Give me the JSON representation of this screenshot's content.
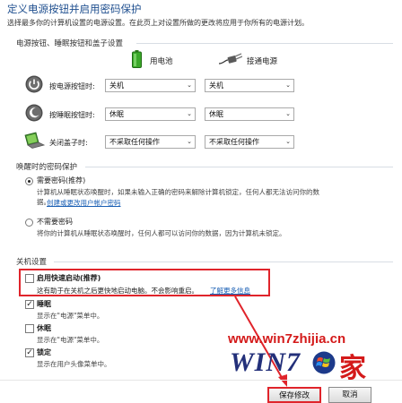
{
  "header": {
    "title": "定义电源按钮并启用密码保护",
    "description": "选择最多你的计算机设置的电源设置。在此页上对设置所做的更改将应用于你所有的电源计划。"
  },
  "power_buttons": {
    "section_title": "电源按钮、睡眠按钮和盖子设置",
    "col_battery": "用电池",
    "col_plugged": "接通电源",
    "rows": [
      {
        "label": "按电源按钮时:",
        "icon": "power-icon",
        "battery": "关机",
        "plugged": "关机"
      },
      {
        "label": "按睡眠按钮时:",
        "icon": "sleep-moon-icon",
        "battery": "休眠",
        "plugged": "休眠"
      },
      {
        "label": "关闭盖子时:",
        "icon": "laptop-lid-icon",
        "battery": "不采取任何操作",
        "plugged": "不采取任何操作"
      }
    ]
  },
  "password": {
    "section_title": "唤醒时的密码保护",
    "option_require": {
      "label": "需要密码(推荐)",
      "desc_line1": "计算机从睡眠状态唤醒时，如果未输入正确的密码来解除计算机锁定，任何人都无法访问你的数",
      "desc_line2": "据。",
      "link": "创建或更改用户帐户密码",
      "selected": true
    },
    "option_none": {
      "label": "不需要密码",
      "desc": "将你的计算机从睡眠状态唤醒时，任何人都可以访问你的数据，因为计算机未锁定。",
      "selected": false
    }
  },
  "shutdown": {
    "section_title": "关机设置",
    "fast_startup": {
      "label": "启用快速启动(推荐)",
      "desc": "这有助于在关机之后更快地启动电脑。不会影响重启。",
      "link": "了解更多信息",
      "checked": false
    },
    "items": [
      {
        "label": "睡眠",
        "desc": "显示在\"电源\"菜单中。",
        "checked": true
      },
      {
        "label": "休眠",
        "desc": "显示在\"电源\"菜单中。",
        "checked": false
      },
      {
        "label": "锁定",
        "desc": "显示在用户头像菜单中。",
        "checked": true
      }
    ]
  },
  "buttons": {
    "save": "保存修改",
    "cancel": "取消"
  },
  "watermark": {
    "url": "www.win7zhijia.cn",
    "logo": "WIN7",
    "jia": "家"
  },
  "colors": {
    "title": "#1f4f8f",
    "link": "#1a5fb4",
    "highlight": "#e0242b",
    "watermark_red": "#d41a1a"
  }
}
